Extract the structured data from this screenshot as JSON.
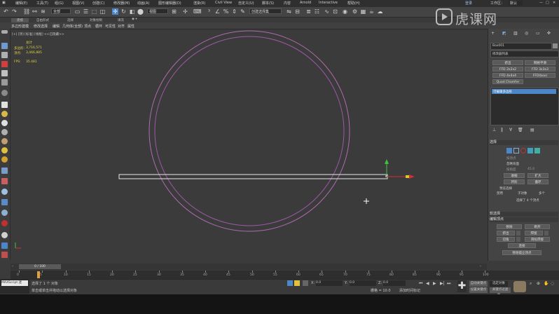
{
  "menu": {
    "items": [
      "编辑(E)",
      "工具(T)",
      "组(G)",
      "视图(V)",
      "创建(C)",
      "修改器(M)",
      "动画(A)",
      "图形编辑器(D)",
      "渲染(R)",
      "Civil View",
      "自定义(U)",
      "脚本(S)",
      "内容",
      "Arnold",
      "Interactive",
      "帮助(H)"
    ],
    "workspace_label": "工作区：",
    "workspace_value": "默认",
    "login_label": "登录"
  },
  "toolbar": {
    "filter_value": "全部",
    "view_value": "视图",
    "selection_set": "创建选择集"
  },
  "ribbon": {
    "row1": [
      "建模",
      "自由形式",
      "选择",
      "对象绘制",
      "填充"
    ],
    "row2": [
      "多边形建模",
      "修改选择",
      "编辑",
      "几何体(全部)",
      "顶点",
      "循环",
      "可见性",
      "对齐",
      "属性"
    ]
  },
  "viewport": {
    "label": "[+] [顶] [标准] [线框] <<已隐藏>>",
    "stats_title": "总计",
    "stats_poly_label": "多边形:",
    "stats_poly_value": "3,716,571",
    "stats_vert_label": "顶点:",
    "stats_vert_value": "3,466,885",
    "fps_label": "FPS:",
    "fps_value": "35.481"
  },
  "watermark": {
    "brand": "虎课网"
  },
  "command_panel": {
    "object_name": "Box001",
    "modifier_list_label": "修改器列表",
    "mod_buttons": [
      "挤出",
      "网格平滑",
      "FFD 2x2x2",
      "FFD 3x3x3",
      "FFD 4x4x4",
      "FFD(box)",
      "Quad Chamfer",
      "FFD(cyl)"
    ],
    "stack_item": "可编辑多边形",
    "rollout_selection": "选择",
    "by_vertex": "按顶点",
    "ignore_backfacing": "忽略背面",
    "by_angle": "按角度",
    "angle_value": "45.0",
    "shrink_label": "收缩",
    "grow_label": "扩大",
    "ring_label": "环形",
    "loop_label": "循环",
    "preview_label": "预览选择",
    "disabled_label": "禁用",
    "subobj_label": "子对象",
    "multi_label": "多个",
    "selected_status": "选择了 4 个顶点",
    "soft_selection": "软选择",
    "edit_vertices": "编辑顶点",
    "remove_label": "移除",
    "break_label": "断开",
    "extrude_label": "挤出",
    "weld_label": "焊接",
    "chamfer_label": "切角",
    "target_weld_label": "目标焊接",
    "connect_label": "连接",
    "remove_isolated": "移除孤立顶点"
  },
  "timeline": {
    "frame_display": "0 / 100",
    "ticks": [
      "0",
      "5",
      "10",
      "15",
      "20",
      "25",
      "30",
      "35",
      "40",
      "45",
      "50",
      "55",
      "60",
      "65",
      "70",
      "75",
      "80",
      "85",
      "90",
      "95",
      "100"
    ]
  },
  "status": {
    "script_label": "MAXScript 迷",
    "selected_objects": "选择了 1 个 对象",
    "hint": "单击或单击并拖动以选择对象",
    "x_label": "X:",
    "x_value": "0.0",
    "y_label": "Y:",
    "y_value": "0.0",
    "z_label": "Z:",
    "z_value": "0.0",
    "grid_label": "栅格 = 10.0",
    "add_time_tag": "添加时间标记",
    "auto_key": "自动关键点",
    "selected_obj": "选定对象",
    "set_key": "设置关键点",
    "key_filters": "关键点过滤器..."
  },
  "colors": {
    "circle_outer": "#b06ab0",
    "circle_inner": "#9b58a6",
    "axis_x": "#d03030",
    "axis_y": "#40c040",
    "accent": "#4a86c8"
  }
}
